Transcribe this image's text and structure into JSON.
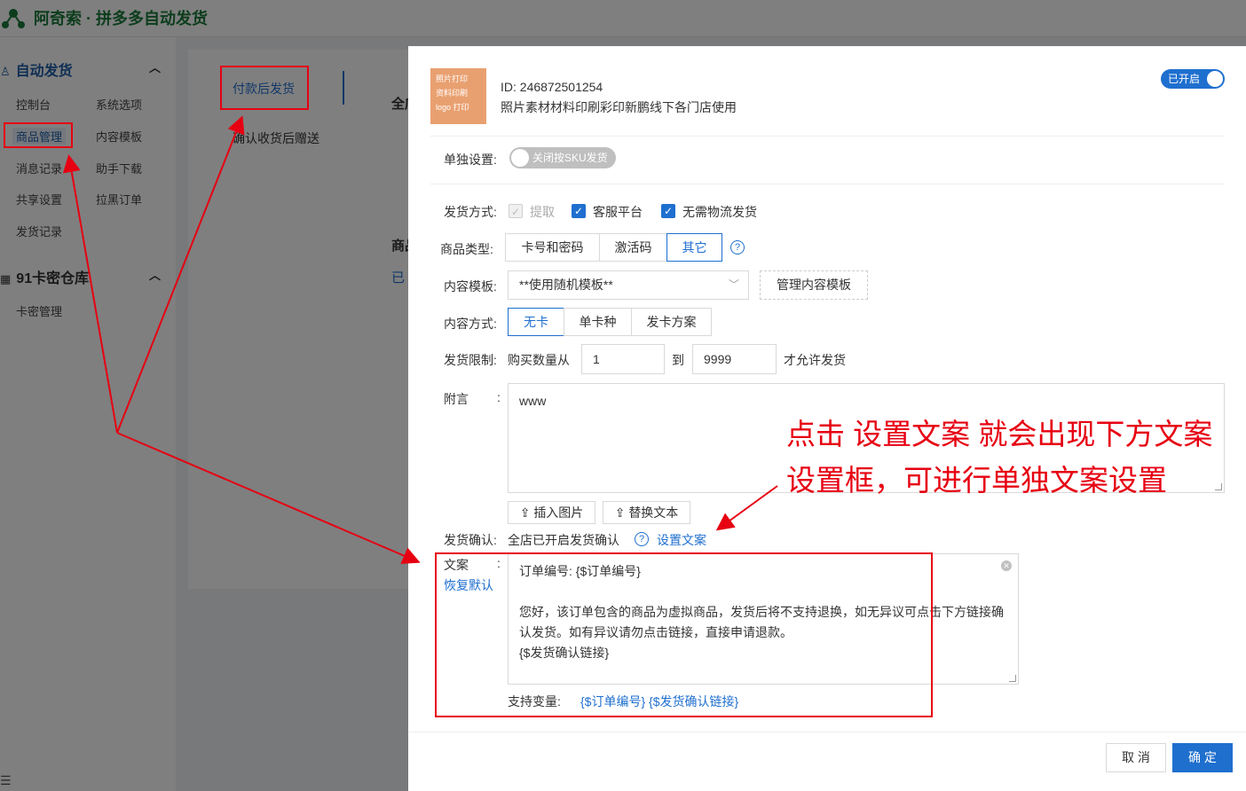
{
  "app": {
    "title": "阿奇索 · 拼多多自动发货"
  },
  "sidebar": {
    "group1": {
      "label": "自动发货",
      "items": [
        "控制台",
        "系统选项",
        "商品管理",
        "内容模板",
        "消息记录",
        "助手下载",
        "共享设置",
        "拉黑订单",
        "发货记录"
      ]
    },
    "group2": {
      "label": "91卡密仓库",
      "items": [
        "卡密管理"
      ]
    }
  },
  "subnav": {
    "active": "付款后发货",
    "other": "确认收货后赠送"
  },
  "background_peek": [
    "全店",
    "商品",
    "已"
  ],
  "drawer": {
    "thumbnail_text": [
      "照片打印",
      "资料印刷",
      "logo 打印"
    ],
    "product_id": "ID:  246872501254",
    "product_name": "照片素材材料印刷彩印新鹏线下各门店使用",
    "enabled_label": "已开启",
    "single_setting": {
      "label": "单独设置:",
      "toggle_text": "关闭按SKU发货"
    },
    "delivery_method": {
      "label": "发货方式:",
      "options": [
        "提取",
        "客服平台",
        "无需物流发货"
      ]
    },
    "product_type": {
      "label": "商品类型:",
      "options": [
        "卡号和密码",
        "激活码",
        "其它"
      ],
      "selected": "其它"
    },
    "content_template": {
      "label": "内容模板:",
      "value": "**使用随机模板**",
      "manage_label": "管理内容模板"
    },
    "content_method": {
      "label": "内容方式:",
      "options": [
        "无卡",
        "单卡种",
        "发卡方案"
      ],
      "selected": "无卡"
    },
    "delivery_limit": {
      "label": "发货限制:",
      "prefix": "购买数量从",
      "min": "1",
      "to": "到",
      "max": "9999",
      "suffix": "才允许发货"
    },
    "note": {
      "label": "附言",
      "colon": ":",
      "value": "www"
    },
    "note_actions": [
      "插入图片",
      "替换文本"
    ],
    "delivery_confirm": {
      "label": "发货确认:",
      "text": "全店已开启发货确认",
      "link": "设置文案"
    },
    "copy": {
      "label": "文案",
      "colon": ":",
      "reset": "恢复默认",
      "line1": "订单编号: {$订单编号}",
      "line2": "您好，该订单包含的商品为虚拟商品，发货后将不支持退换，如无异议可点击下方链接确认发货。如有异议请勿点击链接，直接申请退款。",
      "line3": "{$发货确认链接}",
      "vars_label": "支持变量:",
      "vars": "{$订单编号} {$发货确认链接}"
    },
    "footer": {
      "cancel": "取 消",
      "ok": "确 定"
    }
  },
  "annotation": {
    "text": "点击 设置文案 就会出现下方文案设置框，可进行单独文案设置"
  }
}
